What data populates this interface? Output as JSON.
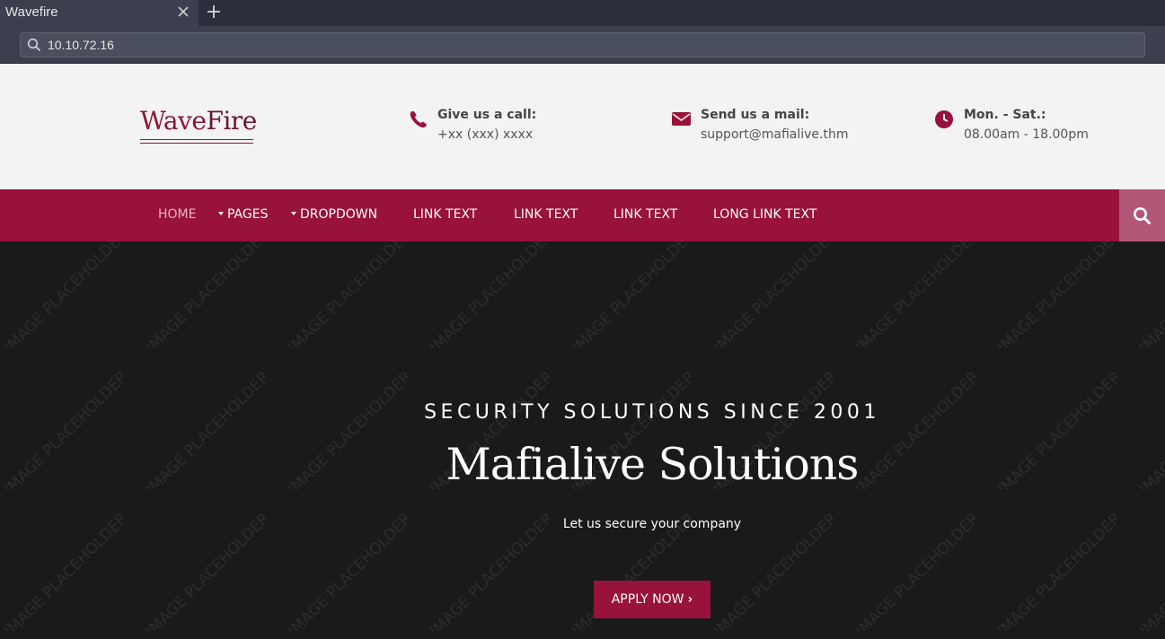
{
  "browser": {
    "tab_title": "Wavefire",
    "url": "10.10.72.16"
  },
  "header": {
    "logo": {
      "part1": "Wave",
      "part2": "Fire"
    },
    "contacts": [
      {
        "icon": "phone-icon",
        "label": "Give us a call:",
        "value": "+xx (xxx) xxxx"
      },
      {
        "icon": "envelope-icon",
        "label": "Send us a mail:",
        "value": "support@mafialive.thm"
      },
      {
        "icon": "clock-icon",
        "label": "Mon. - Sat.:",
        "value": "08.00am - 18.00pm"
      }
    ]
  },
  "nav": {
    "items": [
      {
        "label": "HOME",
        "active": true
      },
      {
        "label": "PAGES",
        "dropdown": true
      },
      {
        "label": "DROPDOWN",
        "dropdown": true
      },
      {
        "label": "LINK TEXT"
      },
      {
        "label": "LINK TEXT"
      },
      {
        "label": "LINK TEXT"
      },
      {
        "label": "LONG LINK TEXT"
      }
    ],
    "search_icon": "search-icon"
  },
  "hero": {
    "watermark": "IMAGE PLACEHOLDER",
    "eyebrow": "SECURITY SOLUTIONS SINCE 2001",
    "title": "Mafialive Solutions",
    "subtitle": "Let us secure your company",
    "cta": "APPLY NOW"
  },
  "colors": {
    "brand": "#98123b",
    "header_bg": "#f3f3f3",
    "hero_bg": "#1a1a1b"
  }
}
